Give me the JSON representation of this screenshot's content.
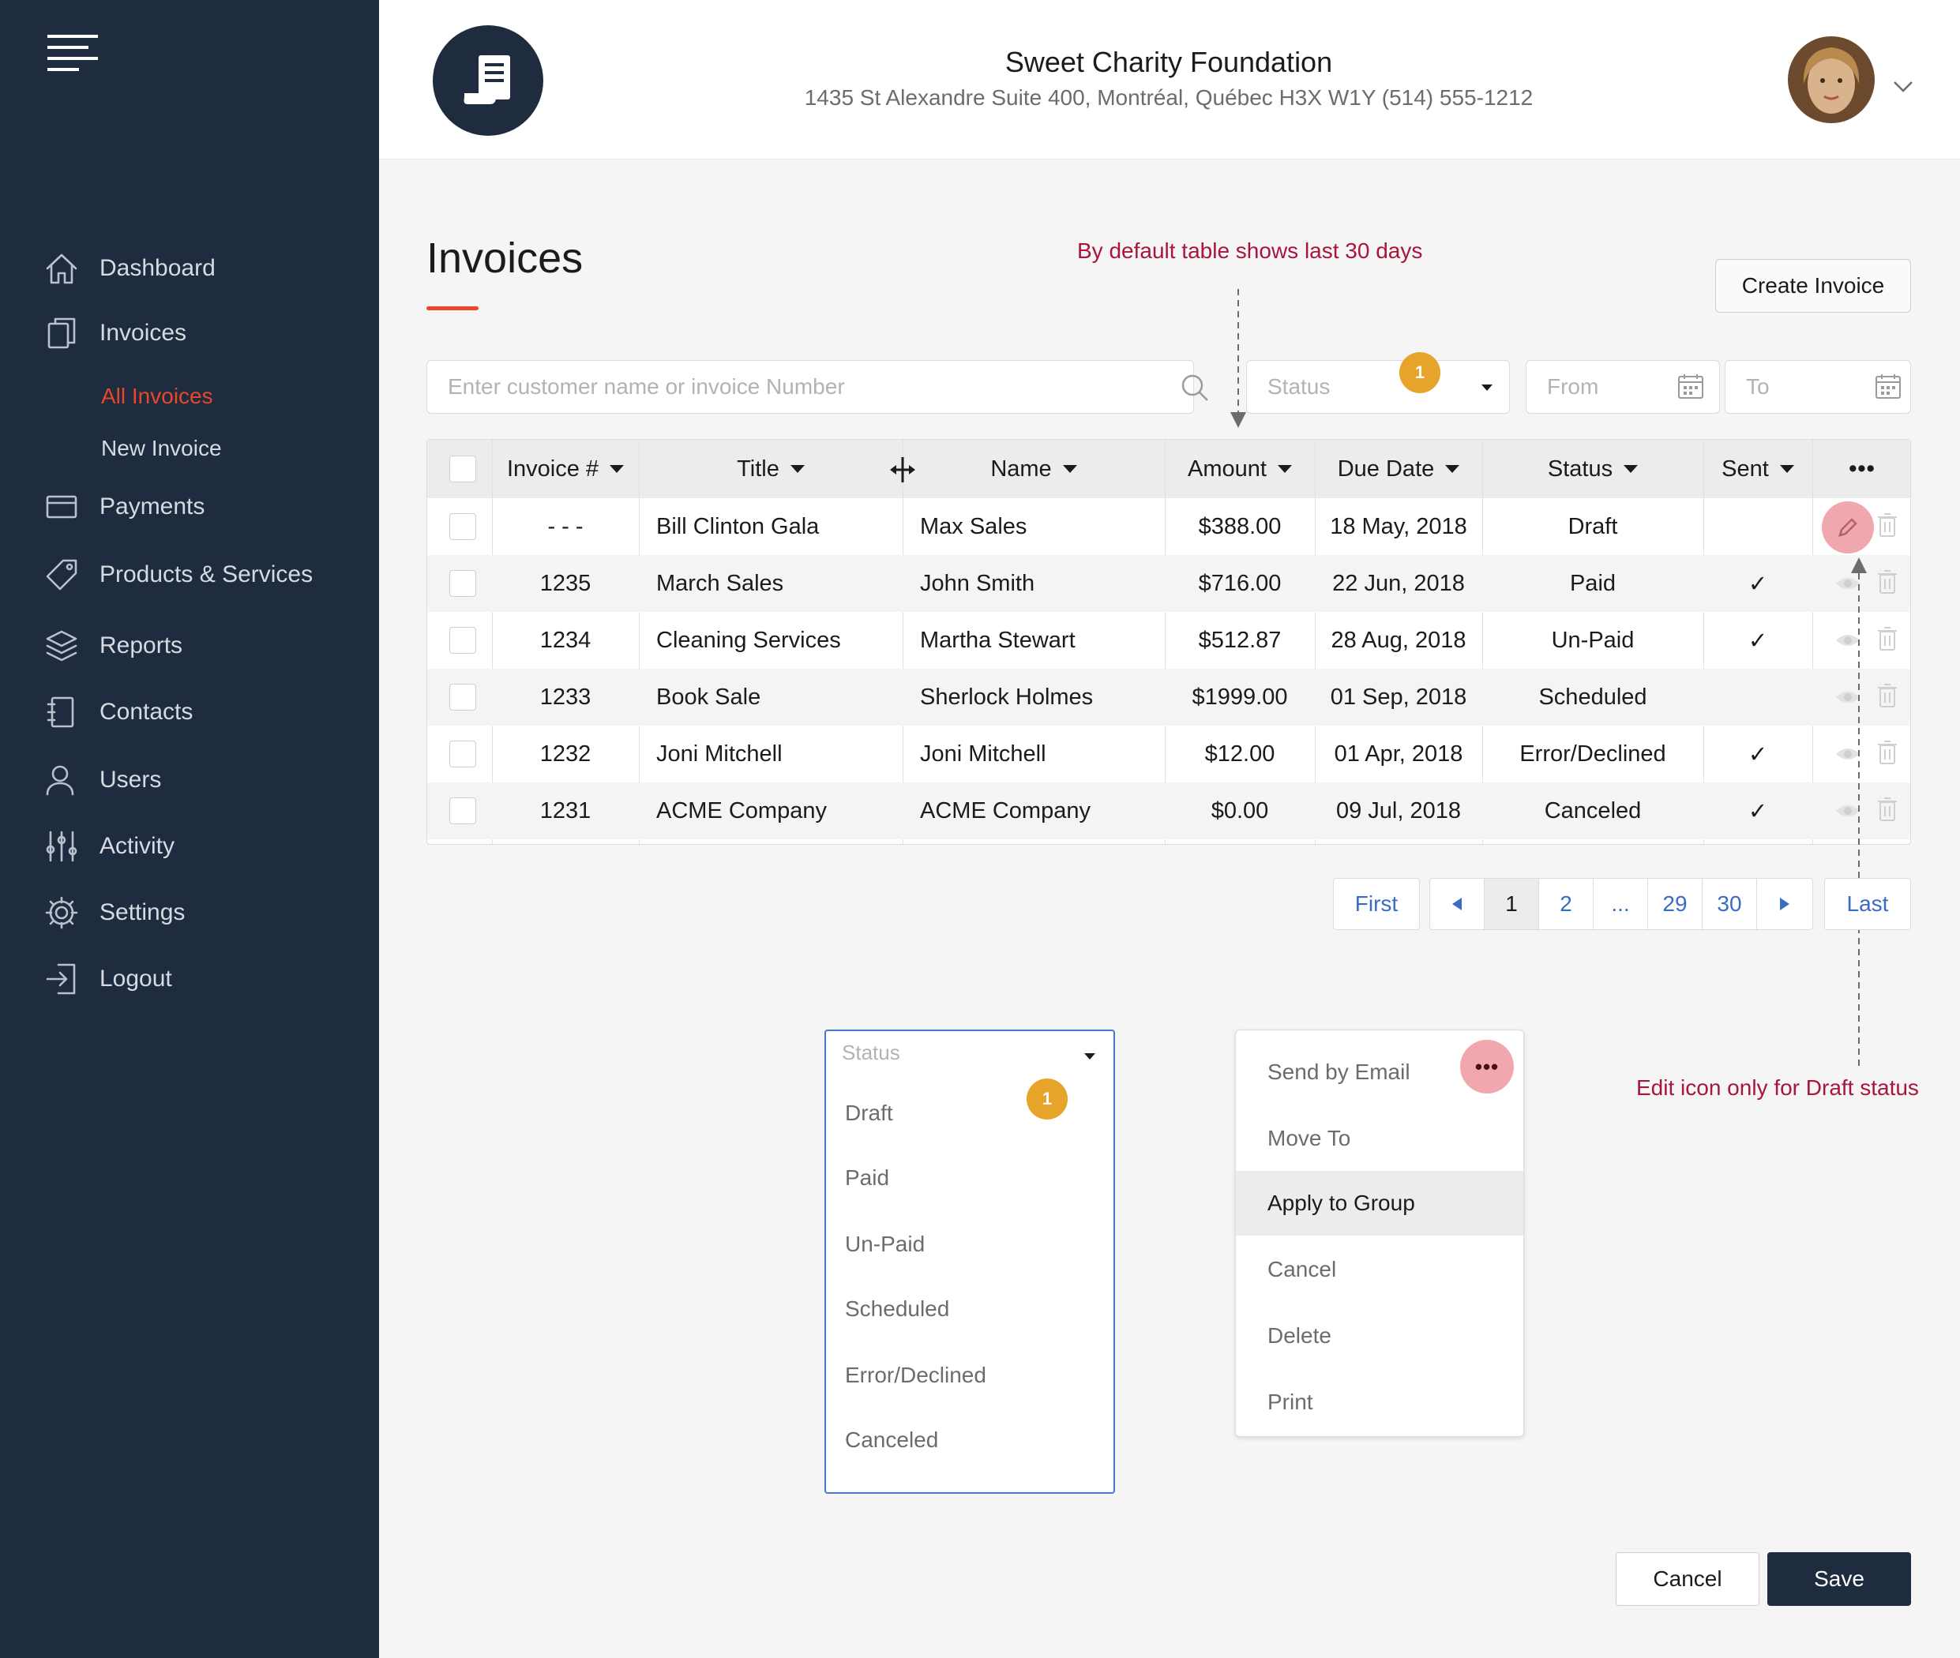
{
  "header": {
    "org_name": "Sweet Charity Foundation",
    "org_address": "1435 St Alexandre Suite 400, Montréal, Québec H3X W1Y (514) 555-1212"
  },
  "sidebar": {
    "items": [
      {
        "label": "Dashboard",
        "icon": "home-icon"
      },
      {
        "label": "Invoices",
        "icon": "invoices-icon"
      },
      {
        "label": "Payments",
        "icon": "card-icon"
      },
      {
        "label": "Products & Services",
        "icon": "tag-icon"
      },
      {
        "label": "Reports",
        "icon": "layers-icon"
      },
      {
        "label": "Contacts",
        "icon": "address-book-icon"
      },
      {
        "label": "Users",
        "icon": "user-icon"
      },
      {
        "label": "Activity",
        "icon": "sliders-icon"
      },
      {
        "label": "Settings",
        "icon": "gear-icon"
      },
      {
        "label": "Logout",
        "icon": "logout-icon"
      }
    ],
    "sub_items": [
      {
        "label": "All Invoices",
        "active": true
      },
      {
        "label": "New Invoice",
        "active": false
      }
    ]
  },
  "page": {
    "title": "Invoices",
    "create_button": "Create Invoice",
    "annotation_default": "By default table shows last 30 days",
    "annotation_edit": "Edit icon only for Draft status"
  },
  "filters": {
    "search_placeholder": "Enter customer name or invoice Number",
    "status_placeholder": "Status",
    "status_badge": "1",
    "from_placeholder": "From",
    "to_placeholder": "To"
  },
  "table": {
    "columns": [
      "Invoice #",
      "Title",
      "Name",
      "Amount",
      "Due Date",
      "Status",
      "Sent",
      "•••"
    ],
    "rows": [
      {
        "invoice": "- - -",
        "title": "Bill Clinton Gala",
        "name": "Max Sales",
        "amount": "$388.00",
        "due": "18 May, 2018",
        "status": "Draft",
        "sent": ""
      },
      {
        "invoice": "1235",
        "title": "March Sales",
        "name": "John Smith",
        "amount": "$716.00",
        "due": "22 Jun, 2018",
        "status": "Paid",
        "sent": "✓"
      },
      {
        "invoice": "1234",
        "title": "Cleaning Services",
        "name": "Martha Stewart",
        "amount": "$512.87",
        "due": "28 Aug, 2018",
        "status": "Un-Paid",
        "sent": "✓"
      },
      {
        "invoice": "1233",
        "title": "Book Sale",
        "name": "Sherlock Holmes",
        "amount": "$1999.00",
        "due": "01 Sep, 2018",
        "status": "Scheduled",
        "sent": ""
      },
      {
        "invoice": "1232",
        "title": "Joni Mitchell",
        "name": "Joni Mitchell",
        "amount": "$12.00",
        "due": "01 Apr, 2018",
        "status": "Error/Declined",
        "sent": "✓"
      },
      {
        "invoice": "1231",
        "title": "ACME Company",
        "name": "ACME Company",
        "amount": "$0.00",
        "due": "09 Jul, 2018",
        "status": "Canceled",
        "sent": "✓"
      }
    ]
  },
  "pagination": {
    "first": "First",
    "pages": [
      "1",
      "2",
      "...",
      "29",
      "30"
    ],
    "current": "1",
    "last": "Last"
  },
  "status_dropdown": {
    "label": "Status",
    "badge": "1",
    "options": [
      "Draft",
      "Paid",
      "Un-Paid",
      "Scheduled",
      "Error/Declined",
      "Canceled"
    ]
  },
  "actions_menu": {
    "options": [
      "Send by Email",
      "Move To",
      "Apply to Group",
      "Cancel",
      "Delete",
      "Print"
    ],
    "highlighted": "Apply to Group",
    "more_glyph": "•••"
  },
  "footer": {
    "cancel": "Cancel",
    "save": "Save"
  },
  "colors": {
    "sidebar_bg": "#1f2b3e",
    "accent_orange": "#e8472a",
    "annotation_red": "#a8163b",
    "badge_amber": "#e7a42a",
    "link_blue": "#3b6cc4"
  }
}
